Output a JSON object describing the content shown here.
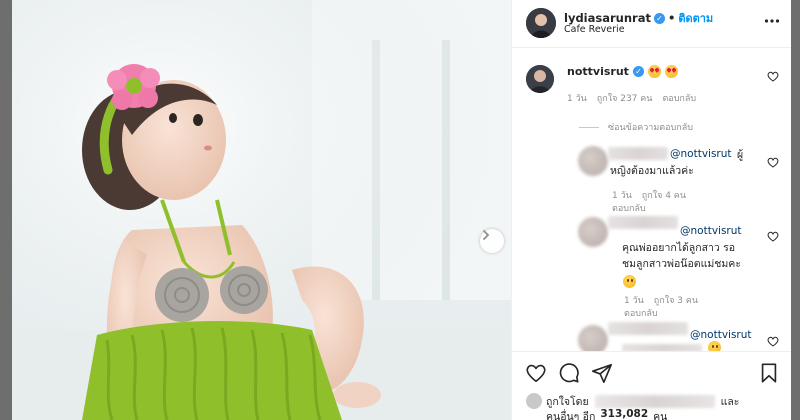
{
  "post": {
    "owner": {
      "username": "lydiasarunrat",
      "follow_label": "ติดตาม",
      "separator": "•",
      "location": "Cafe Reverie",
      "verified_icon": "verified-badge-icon",
      "more_icon": "more-options-icon"
    },
    "photo": {
      "subject": "baby-in-crochet-outfit",
      "next_icon": "chevron-right-icon",
      "colors": {
        "flower": "#f07fae",
        "crochet_green": "#8fbf2a",
        "crochet_grey": "#a8a49f"
      }
    },
    "comments": [
      {
        "username": "nottvisrut",
        "verified": true,
        "emojis": [
          "heart-eyes-emoji",
          "heart-eyes-emoji"
        ],
        "time": "1 วัน",
        "likes": "ถูกใจ 237 คน",
        "reply_label": "ตอบกลับ",
        "hide_replies": "ซ่อนข้อความตอบกลับ"
      }
    ],
    "replies": [
      {
        "mention": "@nottvisrut",
        "text_line1": "ผู้",
        "text_line2": "หญิงต้องมาแล้วค่ะ",
        "time": "1 วัน",
        "likes": "ถูกใจ 4 คน",
        "reply_label": "ตอบกลับ"
      },
      {
        "mention": "@nottvisrut",
        "text_line1": "คุณพ่ออยากได้ลูกสาว รอ",
        "text_line2": "ชมลูกสาวพ่อน๊อตแม่ชมคะ",
        "emoji": "grinning-emoji",
        "time": "1 วัน",
        "likes": "ถูกใจ 3 คน",
        "reply_label": "ตอบกลับ"
      },
      {
        "mention": "@nottvisrut",
        "emoji": "grinning-emoji"
      }
    ],
    "actions": {
      "like_icon": "heart-icon",
      "comment_icon": "comment-icon",
      "share_icon": "paper-plane-icon",
      "save_icon": "bookmark-icon"
    },
    "likes_summary": {
      "prefix": "ถูกใจโดย",
      "and": "และ",
      "others_prefix": "คนอื่นๆ อีก",
      "count": "313,082",
      "suffix": "คน"
    }
  },
  "colors": {
    "link_blue": "#0095f6",
    "mention": "#00376b",
    "muted": "#8e8e8e",
    "text": "#262626",
    "backdrop": "#6e6e6e"
  }
}
